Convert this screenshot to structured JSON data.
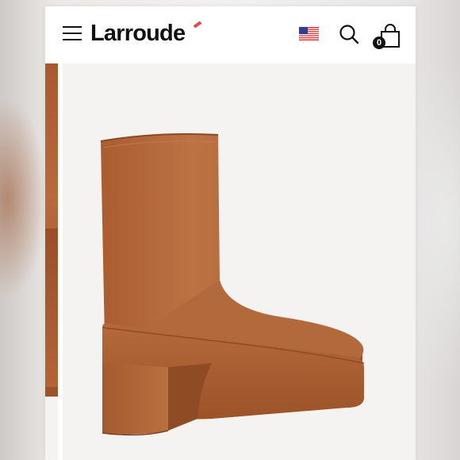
{
  "header": {
    "logo_text": "Larroude",
    "cart_count": "0",
    "accent_color": "#e4484a"
  },
  "icons": {
    "menu": "hamburger-menu-icon",
    "locale": "us-flag-icon",
    "search": "search-icon",
    "cart": "shopping-bag-icon"
  },
  "product": {
    "image": "brown-leather-platform-ankle-boot",
    "color": "#b46a3b"
  }
}
